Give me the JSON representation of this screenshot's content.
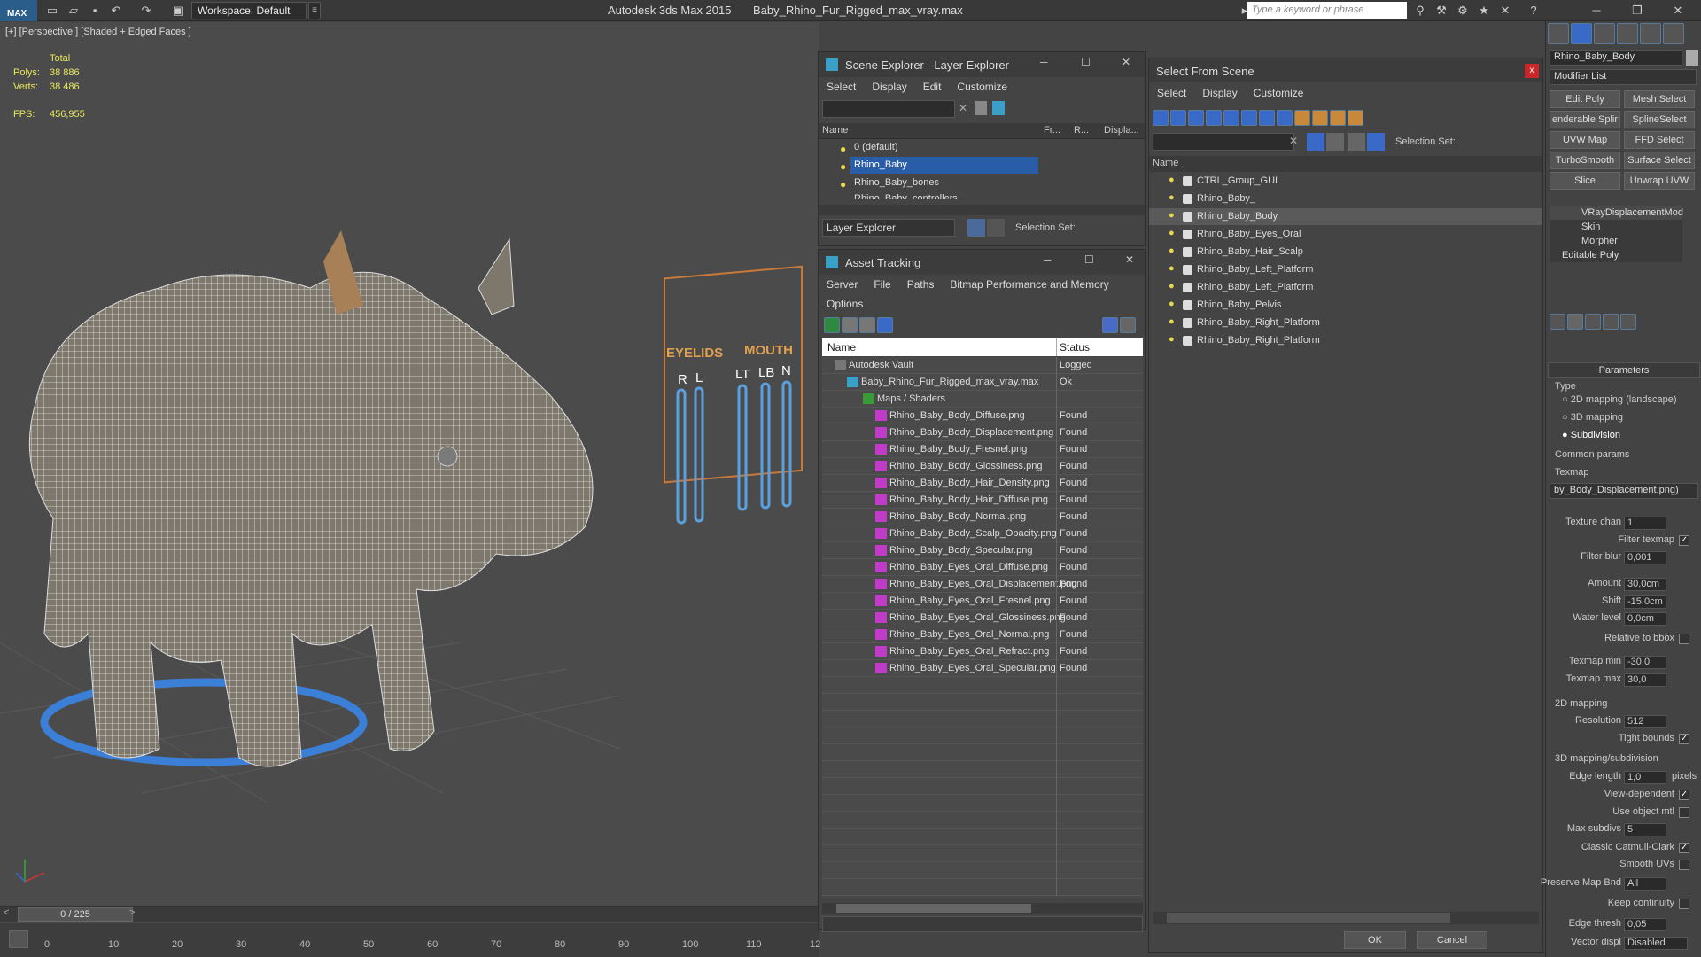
{
  "titlebar": {
    "logo": "MAX",
    "workspace": "Workspace: Default",
    "app_title": "Autodesk 3ds Max  2015",
    "file_title": "Baby_Rhino_Fur_Rigged_max_vray.max",
    "search_placeholder": "Type a keyword or phrase"
  },
  "viewport": {
    "label": "[+] [Perspective ] [Shaded + Edged Faces ]",
    "total_label": "Total",
    "polys_label": "Polys:",
    "polys_value": "38 886",
    "verts_label": "Verts:",
    "verts_value": "38 486",
    "fps_label": "FPS:",
    "fps_value": "456,955",
    "gui_eyelids": "EYELIDS",
    "gui_mouth": "MOUTH",
    "gui_r": "R",
    "gui_l": "L",
    "gui_lt": "LT",
    "gui_lb": "LB",
    "gui_n": "N",
    "frame_slider": "0 / 225",
    "ticks": [
      "0",
      "10",
      "20",
      "30",
      "40",
      "50",
      "60",
      "70",
      "80",
      "90",
      "100",
      "110",
      "12"
    ]
  },
  "scene_explorer": {
    "title": "Scene Explorer - Layer Explorer",
    "menu": [
      "Select",
      "Display",
      "Edit",
      "Customize"
    ],
    "columns": [
      "Name",
      "Fr...",
      "R...",
      "Displa..."
    ],
    "rows": [
      "0 (default)",
      "Rhino_Baby",
      "Rhino_Baby_bones",
      "Rhino_Baby_controllers"
    ],
    "footer_dropdown": "Layer Explorer",
    "selection_set": "Selection Set:"
  },
  "asset_tracking": {
    "title": "Asset Tracking",
    "menu": [
      "Server",
      "File",
      "Paths",
      "Bitmap Performance and Memory"
    ],
    "menu2": "Options",
    "col_name": "Name",
    "col_status": "Status",
    "rows": [
      {
        "name": "Autodesk Vault",
        "status": "Logged"
      },
      {
        "name": "Baby_Rhino_Fur_Rigged_max_vray.max",
        "status": "Ok"
      },
      {
        "name": "Maps / Shaders",
        "status": ""
      },
      {
        "name": "Rhino_Baby_Body_Diffuse.png",
        "status": "Found"
      },
      {
        "name": "Rhino_Baby_Body_Displacement.png",
        "status": "Found"
      },
      {
        "name": "Rhino_Baby_Body_Fresnel.png",
        "status": "Found"
      },
      {
        "name": "Rhino_Baby_Body_Glossiness.png",
        "status": "Found"
      },
      {
        "name": "Rhino_Baby_Body_Hair_Density.png",
        "status": "Found"
      },
      {
        "name": "Rhino_Baby_Body_Hair_Diffuse.png",
        "status": "Found"
      },
      {
        "name": "Rhino_Baby_Body_Normal.png",
        "status": "Found"
      },
      {
        "name": "Rhino_Baby_Body_Scalp_Opacity.png",
        "status": "Found"
      },
      {
        "name": "Rhino_Baby_Body_Specular.png",
        "status": "Found"
      },
      {
        "name": "Rhino_Baby_Eyes_Oral_Diffuse.png",
        "status": "Found"
      },
      {
        "name": "Rhino_Baby_Eyes_Oral_Displacement.png",
        "status": "Found"
      },
      {
        "name": "Rhino_Baby_Eyes_Oral_Fresnel.png",
        "status": "Found"
      },
      {
        "name": "Rhino_Baby_Eyes_Oral_Glossiness.png",
        "status": "Found"
      },
      {
        "name": "Rhino_Baby_Eyes_Oral_Normal.png",
        "status": "Found"
      },
      {
        "name": "Rhino_Baby_Eyes_Oral_Refract.png",
        "status": "Found"
      },
      {
        "name": "Rhino_Baby_Eyes_Oral_Specular.png",
        "status": "Found"
      }
    ]
  },
  "select_from_scene": {
    "title": "Select From Scene",
    "menu": [
      "Select",
      "Display",
      "Customize"
    ],
    "selection_set": "Selection Set:",
    "col_name": "Name",
    "rows": [
      "CTRL_Group_GUI",
      "Rhino_Baby_",
      "Rhino_Baby_Body",
      "Rhino_Baby_Eyes_Oral",
      "Rhino_Baby_Hair_Scalp",
      "Rhino_Baby_Left_Platform",
      "Rhino_Baby_Left_Platform",
      "Rhino_Baby_Pelvis",
      "Rhino_Baby_Right_Platform",
      "Rhino_Baby_Right_Platform"
    ],
    "ok": "OK",
    "cancel": "Cancel"
  },
  "command_panel": {
    "object_name": "Rhino_Baby_Body",
    "modifier_list": "Modifier List",
    "buttons": [
      "Edit Poly",
      "Mesh Select",
      "enderable Splir",
      "SplineSelect",
      "UVW Map",
      "FFD Select",
      "TurboSmooth",
      "Surface Select",
      "Slice",
      "Unwrap UVW"
    ],
    "stack": [
      "VRayDisplacementMod",
      "Skin",
      "Morpher",
      "Editable Poly"
    ],
    "rollout": "Parameters",
    "type_label": "Type",
    "type_options": [
      "2D mapping (landscape)",
      "3D mapping",
      "Subdivision"
    ],
    "common_params": "Common params",
    "texmap_label": "Texmap",
    "texmap_value": "by_Body_Displacement.png)",
    "texture_chan_label": "Texture chan",
    "texture_chan_value": "1",
    "filter_texmap": "Filter texmap",
    "filter_blur_label": "Filter blur",
    "filter_blur_value": "0,001",
    "amount_label": "Amount",
    "amount_value": "30,0cm",
    "shift_label": "Shift",
    "shift_value": "-15,0cm",
    "water_level_label": "Water level",
    "water_level_value": "0,0cm",
    "relative_bbox": "Relative to bbox",
    "texmap_min_label": "Texmap min",
    "texmap_min_value": "-30,0",
    "texmap_max_label": "Texmap max",
    "texmap_max_value": "30,0",
    "mapping2d": "2D mapping",
    "resolution_label": "Resolution",
    "resolution_value": "512",
    "tight_bounds": "Tight bounds",
    "mapping3d": "3D mapping/subdivision",
    "edge_length_label": "Edge length",
    "edge_length_value": "1,0",
    "pixels": "pixels",
    "view_dependent": "View-dependent",
    "use_object_mtl": "Use object mtl",
    "max_subdivs_label": "Max subdivs",
    "max_subdivs_value": "5",
    "classic_cc": "Classic Catmull-Clark",
    "smooth_uvs": "Smooth UVs",
    "preserve_map_bnd": "Preserve Map Bnd",
    "preserve_map_value": "All",
    "keep_continuity": "Keep continuity",
    "edge_thresh_label": "Edge thresh",
    "edge_thresh_value": "0,05",
    "vector_displ_label": "Vector displ",
    "vector_displ_value": "Disabled"
  }
}
